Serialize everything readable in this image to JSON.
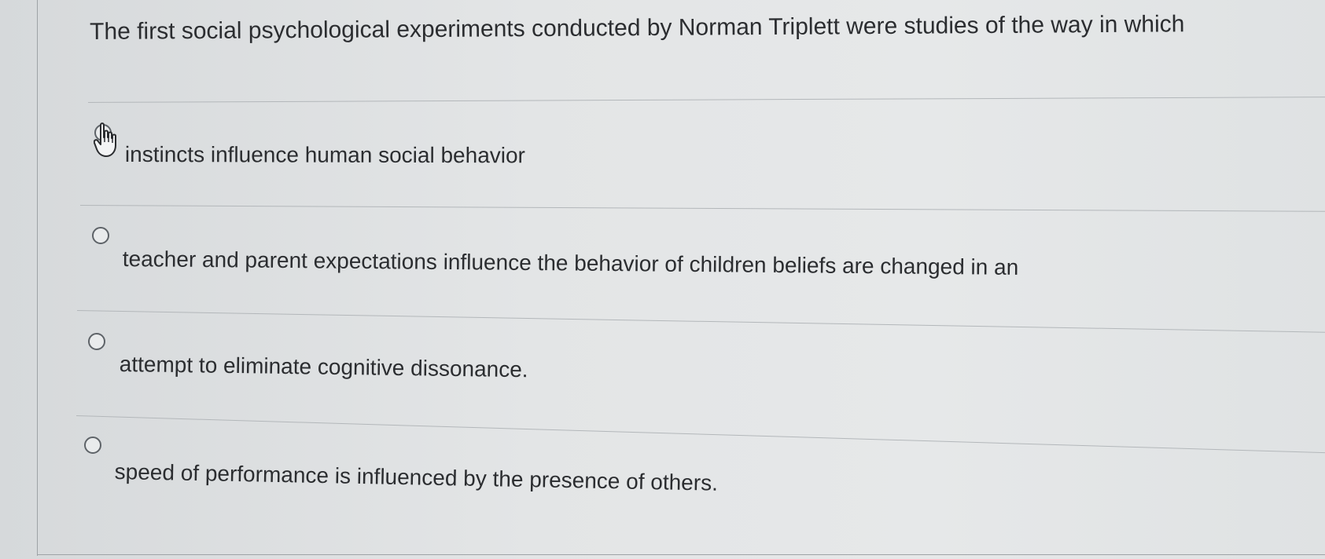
{
  "question": {
    "text": "The first social psychological experiments conducted by Norman Triplett were studies of the way in which"
  },
  "options": [
    {
      "label": "instincts influence human social behavior",
      "selected": false
    },
    {
      "label": "teacher and parent expectations influence the behavior of children beliefs are changed in an",
      "selected": false
    },
    {
      "label": "attempt to eliminate cognitive dissonance.",
      "selected": false
    },
    {
      "label": "speed of performance is influenced by the presence of others.",
      "selected": false
    }
  ],
  "icons": {
    "cursor": "hand-pointer-icon",
    "radio": "radio-circle-icon"
  },
  "colors": {
    "text": "#2b2d30",
    "radio_border": "#5e6368",
    "divider": "#b3b7ba",
    "background": "#e3e5e6"
  }
}
